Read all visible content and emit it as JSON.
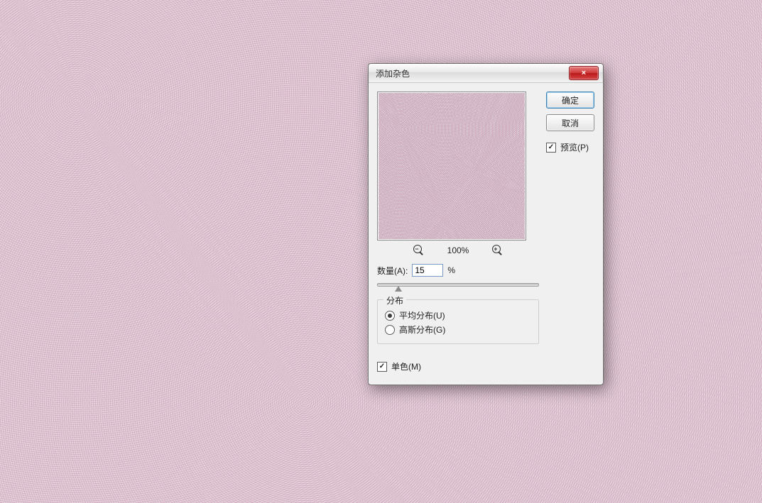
{
  "dialog": {
    "title": "添加杂色",
    "ok_label": "确定",
    "cancel_label": "取消",
    "preview_label": "预览(P)",
    "preview_checked": true,
    "zoom_pct": "100%",
    "amount": {
      "label": "数量(A):",
      "value": "15",
      "unit": "%",
      "slider_pos_pct": 13
    },
    "distribution": {
      "legend": "分布",
      "uniform_label": "平均分布(U)",
      "gaussian_label": "高斯分布(G)",
      "selected": "uniform"
    },
    "monochrome": {
      "label": "单色(M)",
      "checked": true
    },
    "icons": {
      "close": "×",
      "zoom_out_sign": "−",
      "zoom_in_sign": "+"
    },
    "colors": {
      "bg_pink": "#e9d6df",
      "close_red": "#c83232"
    }
  }
}
